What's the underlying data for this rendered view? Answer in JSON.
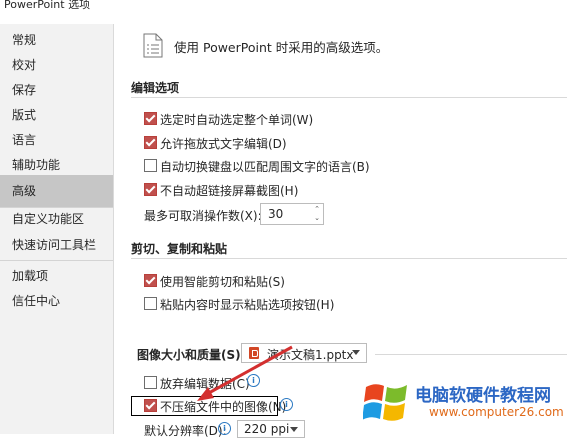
{
  "window": {
    "title": "PowerPoint 选项"
  },
  "sidebar": {
    "items": [
      {
        "label": "常规"
      },
      {
        "label": "校对"
      },
      {
        "label": "保存"
      },
      {
        "label": "版式"
      },
      {
        "label": "语言"
      },
      {
        "label": "辅助功能"
      },
      {
        "label": "高级",
        "active": true
      },
      {
        "label": "自定义功能区"
      },
      {
        "label": "快速访问工具栏"
      },
      {
        "label": "加载项"
      },
      {
        "label": "信任中心"
      }
    ]
  },
  "intro": {
    "text": "使用 PowerPoint 时采用的高级选项。",
    "icon": "document-list-icon"
  },
  "editing": {
    "heading": "编辑选项",
    "options": [
      {
        "label": "选定时自动选定整个单词(W)",
        "checked": true
      },
      {
        "label": "允许拖放式文字编辑(D)",
        "checked": true
      },
      {
        "label": "自动切换键盘以匹配周围文字的语言(B)",
        "checked": false
      },
      {
        "label": "不自动超链接屏幕截图(H)",
        "checked": true
      }
    ],
    "undo_label": "最多可取消操作数(X):",
    "undo_value": "30"
  },
  "clipboard": {
    "heading": "剪切、复制和粘贴",
    "options": [
      {
        "label": "使用智能剪切和粘贴(S)",
        "checked": true
      },
      {
        "label": "粘贴内容时显示粘贴选项按钮(H)",
        "checked": false
      }
    ]
  },
  "image": {
    "heading": "图像大小和质量(S)",
    "file_value": "演示文稿1.pptx",
    "options": [
      {
        "label": "放弃编辑数据(C)",
        "checked": false
      },
      {
        "label": "不压缩文件中的图像(N)",
        "checked": true
      }
    ],
    "resolution_label": "默认分辨率(D):",
    "resolution_value": "220 ppi"
  },
  "watermark": {
    "title": "电脑软硬件教程网",
    "url": "www.computer26.com",
    "colors": {
      "red": "#e8451f",
      "green": "#7cbb2b",
      "blue": "#1e9be2",
      "yellow": "#f5b700"
    }
  },
  "colors": {
    "accent": "#c0504d",
    "annotation": "#d32f2f",
    "info": "#2b79c2"
  }
}
